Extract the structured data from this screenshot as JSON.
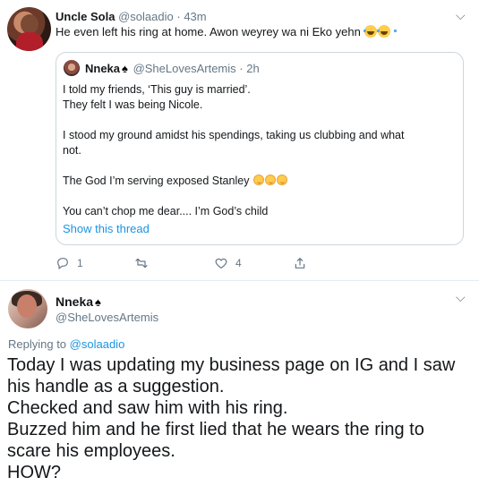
{
  "tweet1": {
    "author_name": "Uncle Sola",
    "handle": "@solaadio",
    "separator": "·",
    "time": "43m",
    "text": "He even left his ring at home. Awon weyrey wa ni Eko yehn",
    "quote": {
      "author_name": "Nneka",
      "handle": "@SheLovesArtemis",
      "separator": "·",
      "time": "2h",
      "lines": [
        "I told my friends, ‘This guy is married’.",
        "They felt I was being Nicole.",
        "",
        "I stood my ground amidst his spendings, taking us clubbing and what",
        "not.",
        "",
        "The God I’m serving exposed Stanley",
        "",
        "You can’t chop me dear.... I’m God’s child"
      ],
      "show_thread": "Show this thread"
    },
    "actions": {
      "reply_count": "1",
      "retweet_count": "",
      "like_count": "4"
    }
  },
  "tweet2": {
    "author_name": "Nneka",
    "handle": "@SheLovesArtemis",
    "replying_prefix": "Replying to",
    "replying_to": "@solaadio",
    "lines": [
      "Today I was updating my business page on IG and I saw",
      "his handle as a suggestion.",
      "Checked and saw him with his ring.",
      "Buzzed him and he first lied that he wears the ring to",
      "scare his employees.",
      "HOW?"
    ]
  },
  "colors": {
    "link": "#1b95e0",
    "secondary_text": "#657786",
    "border": "#e6ecf0"
  },
  "icons": [
    "chevron-down-icon",
    "reply-icon",
    "retweet-icon",
    "like-icon",
    "share-icon",
    "spade-icon",
    "laughing-tears-emoji",
    "smiling-blush-emoji"
  ]
}
